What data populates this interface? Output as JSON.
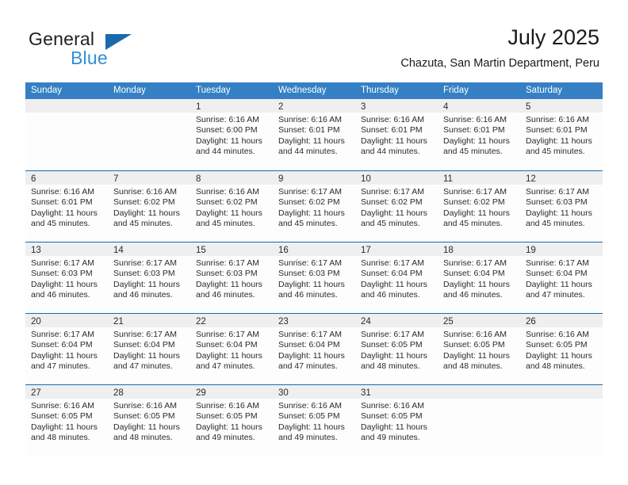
{
  "logo": {
    "word_top": "General",
    "word_bottom": "Blue",
    "triangle_color": "#1a6aab",
    "blue_color": "#2e8fd8"
  },
  "header": {
    "title": "July 2025",
    "subtitle": "Chazuta, San Martin Department, Peru"
  },
  "theme": {
    "header_bar": "#3580c4",
    "week_divider": "#1a6aab",
    "day_band": "#efefef"
  },
  "weekdays": [
    "Sunday",
    "Monday",
    "Tuesday",
    "Wednesday",
    "Thursday",
    "Friday",
    "Saturday"
  ],
  "weeks": [
    [
      {
        "day": "",
        "empty": true
      },
      {
        "day": "",
        "empty": true
      },
      {
        "day": "1",
        "sunrise": "Sunrise: 6:16 AM",
        "sunset": "Sunset: 6:00 PM",
        "daylight1": "Daylight: 11 hours",
        "daylight2": "and 44 minutes."
      },
      {
        "day": "2",
        "sunrise": "Sunrise: 6:16 AM",
        "sunset": "Sunset: 6:01 PM",
        "daylight1": "Daylight: 11 hours",
        "daylight2": "and 44 minutes."
      },
      {
        "day": "3",
        "sunrise": "Sunrise: 6:16 AM",
        "sunset": "Sunset: 6:01 PM",
        "daylight1": "Daylight: 11 hours",
        "daylight2": "and 44 minutes."
      },
      {
        "day": "4",
        "sunrise": "Sunrise: 6:16 AM",
        "sunset": "Sunset: 6:01 PM",
        "daylight1": "Daylight: 11 hours",
        "daylight2": "and 45 minutes."
      },
      {
        "day": "5",
        "sunrise": "Sunrise: 6:16 AM",
        "sunset": "Sunset: 6:01 PM",
        "daylight1": "Daylight: 11 hours",
        "daylight2": "and 45 minutes."
      }
    ],
    [
      {
        "day": "6",
        "sunrise": "Sunrise: 6:16 AM",
        "sunset": "Sunset: 6:01 PM",
        "daylight1": "Daylight: 11 hours",
        "daylight2": "and 45 minutes."
      },
      {
        "day": "7",
        "sunrise": "Sunrise: 6:16 AM",
        "sunset": "Sunset: 6:02 PM",
        "daylight1": "Daylight: 11 hours",
        "daylight2": "and 45 minutes."
      },
      {
        "day": "8",
        "sunrise": "Sunrise: 6:16 AM",
        "sunset": "Sunset: 6:02 PM",
        "daylight1": "Daylight: 11 hours",
        "daylight2": "and 45 minutes."
      },
      {
        "day": "9",
        "sunrise": "Sunrise: 6:17 AM",
        "sunset": "Sunset: 6:02 PM",
        "daylight1": "Daylight: 11 hours",
        "daylight2": "and 45 minutes."
      },
      {
        "day": "10",
        "sunrise": "Sunrise: 6:17 AM",
        "sunset": "Sunset: 6:02 PM",
        "daylight1": "Daylight: 11 hours",
        "daylight2": "and 45 minutes."
      },
      {
        "day": "11",
        "sunrise": "Sunrise: 6:17 AM",
        "sunset": "Sunset: 6:02 PM",
        "daylight1": "Daylight: 11 hours",
        "daylight2": "and 45 minutes."
      },
      {
        "day": "12",
        "sunrise": "Sunrise: 6:17 AM",
        "sunset": "Sunset: 6:03 PM",
        "daylight1": "Daylight: 11 hours",
        "daylight2": "and 45 minutes."
      }
    ],
    [
      {
        "day": "13",
        "sunrise": "Sunrise: 6:17 AM",
        "sunset": "Sunset: 6:03 PM",
        "daylight1": "Daylight: 11 hours",
        "daylight2": "and 46 minutes."
      },
      {
        "day": "14",
        "sunrise": "Sunrise: 6:17 AM",
        "sunset": "Sunset: 6:03 PM",
        "daylight1": "Daylight: 11 hours",
        "daylight2": "and 46 minutes."
      },
      {
        "day": "15",
        "sunrise": "Sunrise: 6:17 AM",
        "sunset": "Sunset: 6:03 PM",
        "daylight1": "Daylight: 11 hours",
        "daylight2": "and 46 minutes."
      },
      {
        "day": "16",
        "sunrise": "Sunrise: 6:17 AM",
        "sunset": "Sunset: 6:03 PM",
        "daylight1": "Daylight: 11 hours",
        "daylight2": "and 46 minutes."
      },
      {
        "day": "17",
        "sunrise": "Sunrise: 6:17 AM",
        "sunset": "Sunset: 6:04 PM",
        "daylight1": "Daylight: 11 hours",
        "daylight2": "and 46 minutes."
      },
      {
        "day": "18",
        "sunrise": "Sunrise: 6:17 AM",
        "sunset": "Sunset: 6:04 PM",
        "daylight1": "Daylight: 11 hours",
        "daylight2": "and 46 minutes."
      },
      {
        "day": "19",
        "sunrise": "Sunrise: 6:17 AM",
        "sunset": "Sunset: 6:04 PM",
        "daylight1": "Daylight: 11 hours",
        "daylight2": "and 47 minutes."
      }
    ],
    [
      {
        "day": "20",
        "sunrise": "Sunrise: 6:17 AM",
        "sunset": "Sunset: 6:04 PM",
        "daylight1": "Daylight: 11 hours",
        "daylight2": "and 47 minutes."
      },
      {
        "day": "21",
        "sunrise": "Sunrise: 6:17 AM",
        "sunset": "Sunset: 6:04 PM",
        "daylight1": "Daylight: 11 hours",
        "daylight2": "and 47 minutes."
      },
      {
        "day": "22",
        "sunrise": "Sunrise: 6:17 AM",
        "sunset": "Sunset: 6:04 PM",
        "daylight1": "Daylight: 11 hours",
        "daylight2": "and 47 minutes."
      },
      {
        "day": "23",
        "sunrise": "Sunrise: 6:17 AM",
        "sunset": "Sunset: 6:04 PM",
        "daylight1": "Daylight: 11 hours",
        "daylight2": "and 47 minutes."
      },
      {
        "day": "24",
        "sunrise": "Sunrise: 6:17 AM",
        "sunset": "Sunset: 6:05 PM",
        "daylight1": "Daylight: 11 hours",
        "daylight2": "and 48 minutes."
      },
      {
        "day": "25",
        "sunrise": "Sunrise: 6:16 AM",
        "sunset": "Sunset: 6:05 PM",
        "daylight1": "Daylight: 11 hours",
        "daylight2": "and 48 minutes."
      },
      {
        "day": "26",
        "sunrise": "Sunrise: 6:16 AM",
        "sunset": "Sunset: 6:05 PM",
        "daylight1": "Daylight: 11 hours",
        "daylight2": "and 48 minutes."
      }
    ],
    [
      {
        "day": "27",
        "sunrise": "Sunrise: 6:16 AM",
        "sunset": "Sunset: 6:05 PM",
        "daylight1": "Daylight: 11 hours",
        "daylight2": "and 48 minutes."
      },
      {
        "day": "28",
        "sunrise": "Sunrise: 6:16 AM",
        "sunset": "Sunset: 6:05 PM",
        "daylight1": "Daylight: 11 hours",
        "daylight2": "and 48 minutes."
      },
      {
        "day": "29",
        "sunrise": "Sunrise: 6:16 AM",
        "sunset": "Sunset: 6:05 PM",
        "daylight1": "Daylight: 11 hours",
        "daylight2": "and 49 minutes."
      },
      {
        "day": "30",
        "sunrise": "Sunrise: 6:16 AM",
        "sunset": "Sunset: 6:05 PM",
        "daylight1": "Daylight: 11 hours",
        "daylight2": "and 49 minutes."
      },
      {
        "day": "31",
        "sunrise": "Sunrise: 6:16 AM",
        "sunset": "Sunset: 6:05 PM",
        "daylight1": "Daylight: 11 hours",
        "daylight2": "and 49 minutes."
      },
      {
        "day": "",
        "empty": true
      },
      {
        "day": "",
        "empty": true
      }
    ]
  ]
}
